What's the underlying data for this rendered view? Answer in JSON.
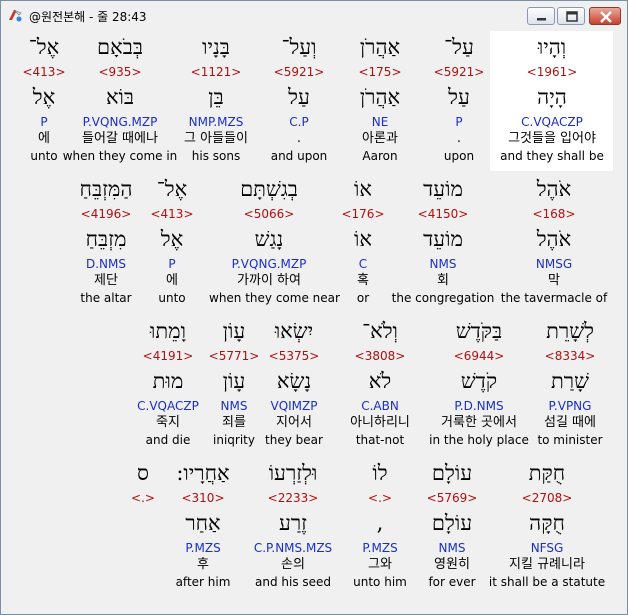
{
  "window": {
    "title": "@원전본해 - 줄 28:43"
  },
  "rows": [
    {
      "words": [
        {
          "heb": "וְהָיוּ",
          "num": "<1961>",
          "lex": "הָיָה",
          "morph": "C.VQACZP",
          "ko": "그것들을 입어야",
          "en": "and they shall be",
          "highlight": true
        },
        {
          "heb": "עַל־",
          "num": "<5921>",
          "lex": "עַל",
          "morph": "P",
          "ko": ".",
          "en": "upon"
        },
        {
          "heb": "אַהֲרֹן",
          "num": "<175>",
          "lex": "אַהֲרֹן",
          "morph": "NE",
          "ko": "아론과",
          "en": "Aaron"
        },
        {
          "heb": "וְעַל־",
          "num": "<5921>",
          "lex": "עַל",
          "morph": "C.P",
          "ko": ".",
          "en": "and upon"
        },
        {
          "heb": "בָּנָיו",
          "num": "<1121>",
          "lex": "בֵּן",
          "morph": "NMP.MZS",
          "ko": "그 아들들이",
          "en": "his sons"
        },
        {
          "heb": "בְּבֹאָם",
          "num": "<935>",
          "lex": "בּוֹא",
          "morph": "P.VQNG.MZP",
          "ko": "들어갈 때에나",
          "en": "when they come in"
        },
        {
          "heb": "אֶל־",
          "num": "<413>",
          "lex": "אֶל",
          "morph": "P",
          "ko": "에",
          "en": "unto"
        }
      ]
    },
    {
      "words": [
        {
          "heb": "אֹהֶל",
          "num": "<168>",
          "lex": "אֹהֶל",
          "morph": "NMSG",
          "ko": "막",
          "en": "the tavermacle of"
        },
        {
          "heb": "מוֹעֵד",
          "num": "<4150>",
          "lex": "מוֹעֵד",
          "morph": "NMS",
          "ko": "회",
          "en": "the congregation"
        },
        {
          "heb": "אוֹ",
          "num": "<176>",
          "lex": "אוֹ",
          "morph": "C",
          "ko": "혹",
          "en": "or"
        },
        {
          "heb": "בְגִשְׁתָּם",
          "num": "<5066>",
          "lex": "נָגַשׁ",
          "morph": "P.VQNG.MZP",
          "ko": "가까이 하여",
          "en": "when they come near"
        },
        {
          "heb": "אֶל־",
          "num": "<413>",
          "lex": "אֶל",
          "morph": "P",
          "ko": "에",
          "en": "unto"
        },
        {
          "heb": "הַמִּזְבֵּחַ",
          "num": "<4196>",
          "lex": "מִזְבֵּחַ",
          "morph": "D.NMS",
          "ko": "제단",
          "en": "the altar"
        }
      ]
    },
    {
      "words": [
        {
          "heb": "לְשָׁרֵת",
          "num": "<8334>",
          "lex": "שָׁרַת",
          "morph": "P.VPNG",
          "ko": "섬길 때에",
          "en": "to minister"
        },
        {
          "heb": "בַּקֹּדֶשׁ",
          "num": "<6944>",
          "lex": "קֹדֶשׁ",
          "morph": "P.D.NMS",
          "ko": "거룩한 곳에서",
          "en": "in the holy place"
        },
        {
          "heb": "וְלֹא־",
          "num": "<3808>",
          "lex": "לֹא",
          "morph": "C.ABN",
          "ko": "아니하리니",
          "en": "that-not"
        },
        {
          "heb": "יִשְׂאוּ",
          "num": "<5375>",
          "lex": "נָשָׂא",
          "morph": "VQIMZP",
          "ko": "지어서",
          "en": "they bear"
        },
        {
          "heb": "עָוֹן",
          "num": "<5771>",
          "lex": "עָוֹן",
          "morph": "NMS",
          "ko": "죄를",
          "en": "iniqrity"
        },
        {
          "heb": "וָמֵתוּ",
          "num": "<4191>",
          "lex": "מוּת",
          "morph": "C.VQACZP",
          "ko": "죽지",
          "en": "and die"
        }
      ]
    },
    {
      "words": [
        {
          "heb": "חֻקַּת",
          "num": "<2708>",
          "lex": "חֻקָּה",
          "morph": "NFSG",
          "ko": "지킬 규례니라",
          "en": "it shall be a statute"
        },
        {
          "heb": "עוֹלָם",
          "num": "<5769>",
          "lex": "עוֹלָם",
          "morph": "NMS",
          "ko": "영원히",
          "en": "for ever"
        },
        {
          "heb": "לוֹ",
          "num": "<.>",
          "lex": ",",
          "morph": "P.MZS",
          "ko": "그와",
          "en": "unto him"
        },
        {
          "heb": "וּלְזַרְעוֹ",
          "num": "<2233>",
          "lex": "זֶרַע",
          "morph": "C.P.NMS.MZS",
          "ko": "손의",
          "en": "and his seed"
        },
        {
          "heb": "אַחֲרָיו:",
          "num": "<310>",
          "lex": "אַחַר",
          "morph": "P.MZS",
          "ko": "후",
          "en": "after him"
        },
        {
          "heb": "ס",
          "num": "<.>",
          "lex": "",
          "morph": "",
          "ko": "",
          "en": ""
        }
      ]
    }
  ]
}
